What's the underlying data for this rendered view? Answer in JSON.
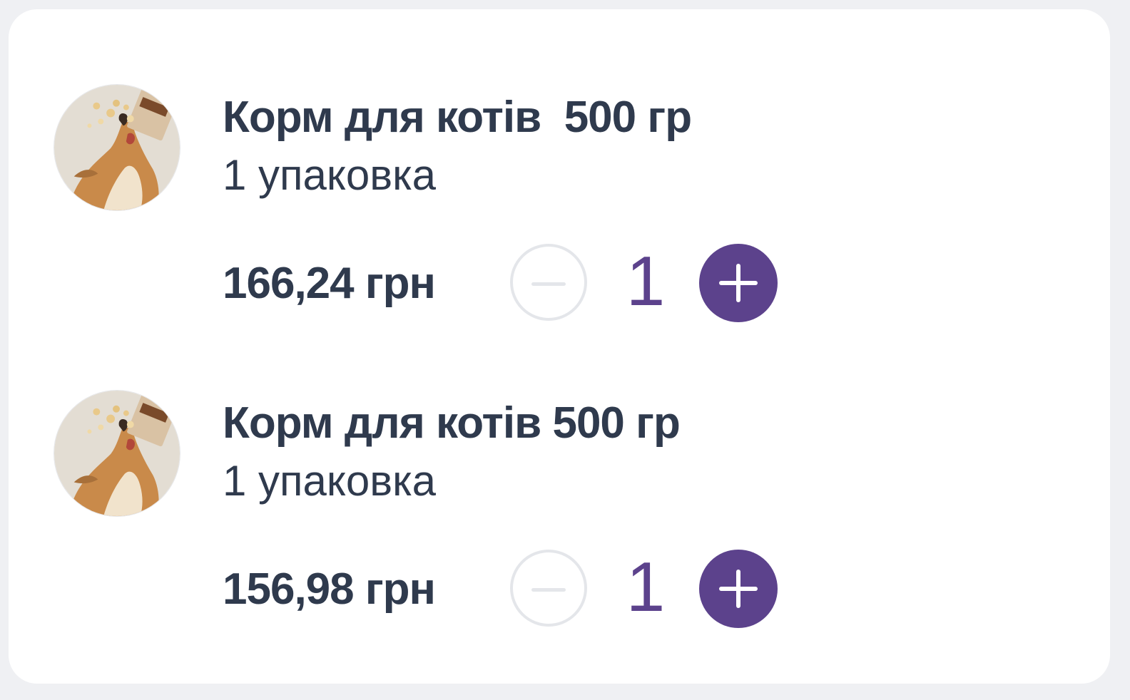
{
  "cart": {
    "items": [
      {
        "title": "Корм для котів  500 гр",
        "subtitle": "1 упаковка",
        "price": "166,24 грн",
        "quantity": "1",
        "image_icon": "dog-food-photo"
      },
      {
        "title": "Корм для котів 500 гр",
        "subtitle": "1 упаковка",
        "price": "156,98 грн",
        "quantity": "1",
        "image_icon": "dog-food-photo"
      }
    ],
    "colors": {
      "accent": "#5c428c",
      "text": "#2f3a4d",
      "disabled": "#e4e6ea"
    }
  }
}
